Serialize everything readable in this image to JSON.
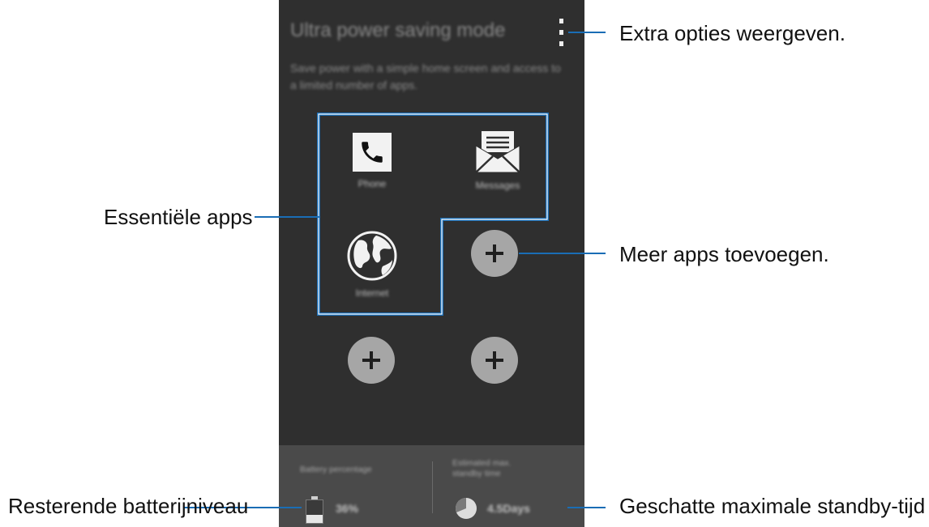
{
  "screen": {
    "title": "Ultra power saving mode",
    "description": "Save power with a simple home screen and access to a limited number of apps.",
    "apps": [
      {
        "label": "Phone",
        "icon": "phone-icon"
      },
      {
        "label": "Messages",
        "icon": "envelope-icon"
      },
      {
        "label": "Internet",
        "icon": "globe-icon"
      }
    ],
    "battery": {
      "label": "Battery percentage",
      "value": "36%",
      "level": 0.36
    },
    "standby": {
      "label": "Estimated max. standby time",
      "value": "4.5Days"
    }
  },
  "annotations": {
    "more_options": "Extra opties weergeven.",
    "essential_apps": "Essentiële apps",
    "add_apps": "Meer apps toevoegen.",
    "battery_level": "Resterende batterijniveau",
    "standby_time": "Geschatte maximale standby-tijd"
  },
  "colors": {
    "screen_background": "#2f2f2f",
    "bottom_panel": "#4a4a4a",
    "add_button": "#a6a6a6",
    "callout_line": "#1a6db5"
  }
}
